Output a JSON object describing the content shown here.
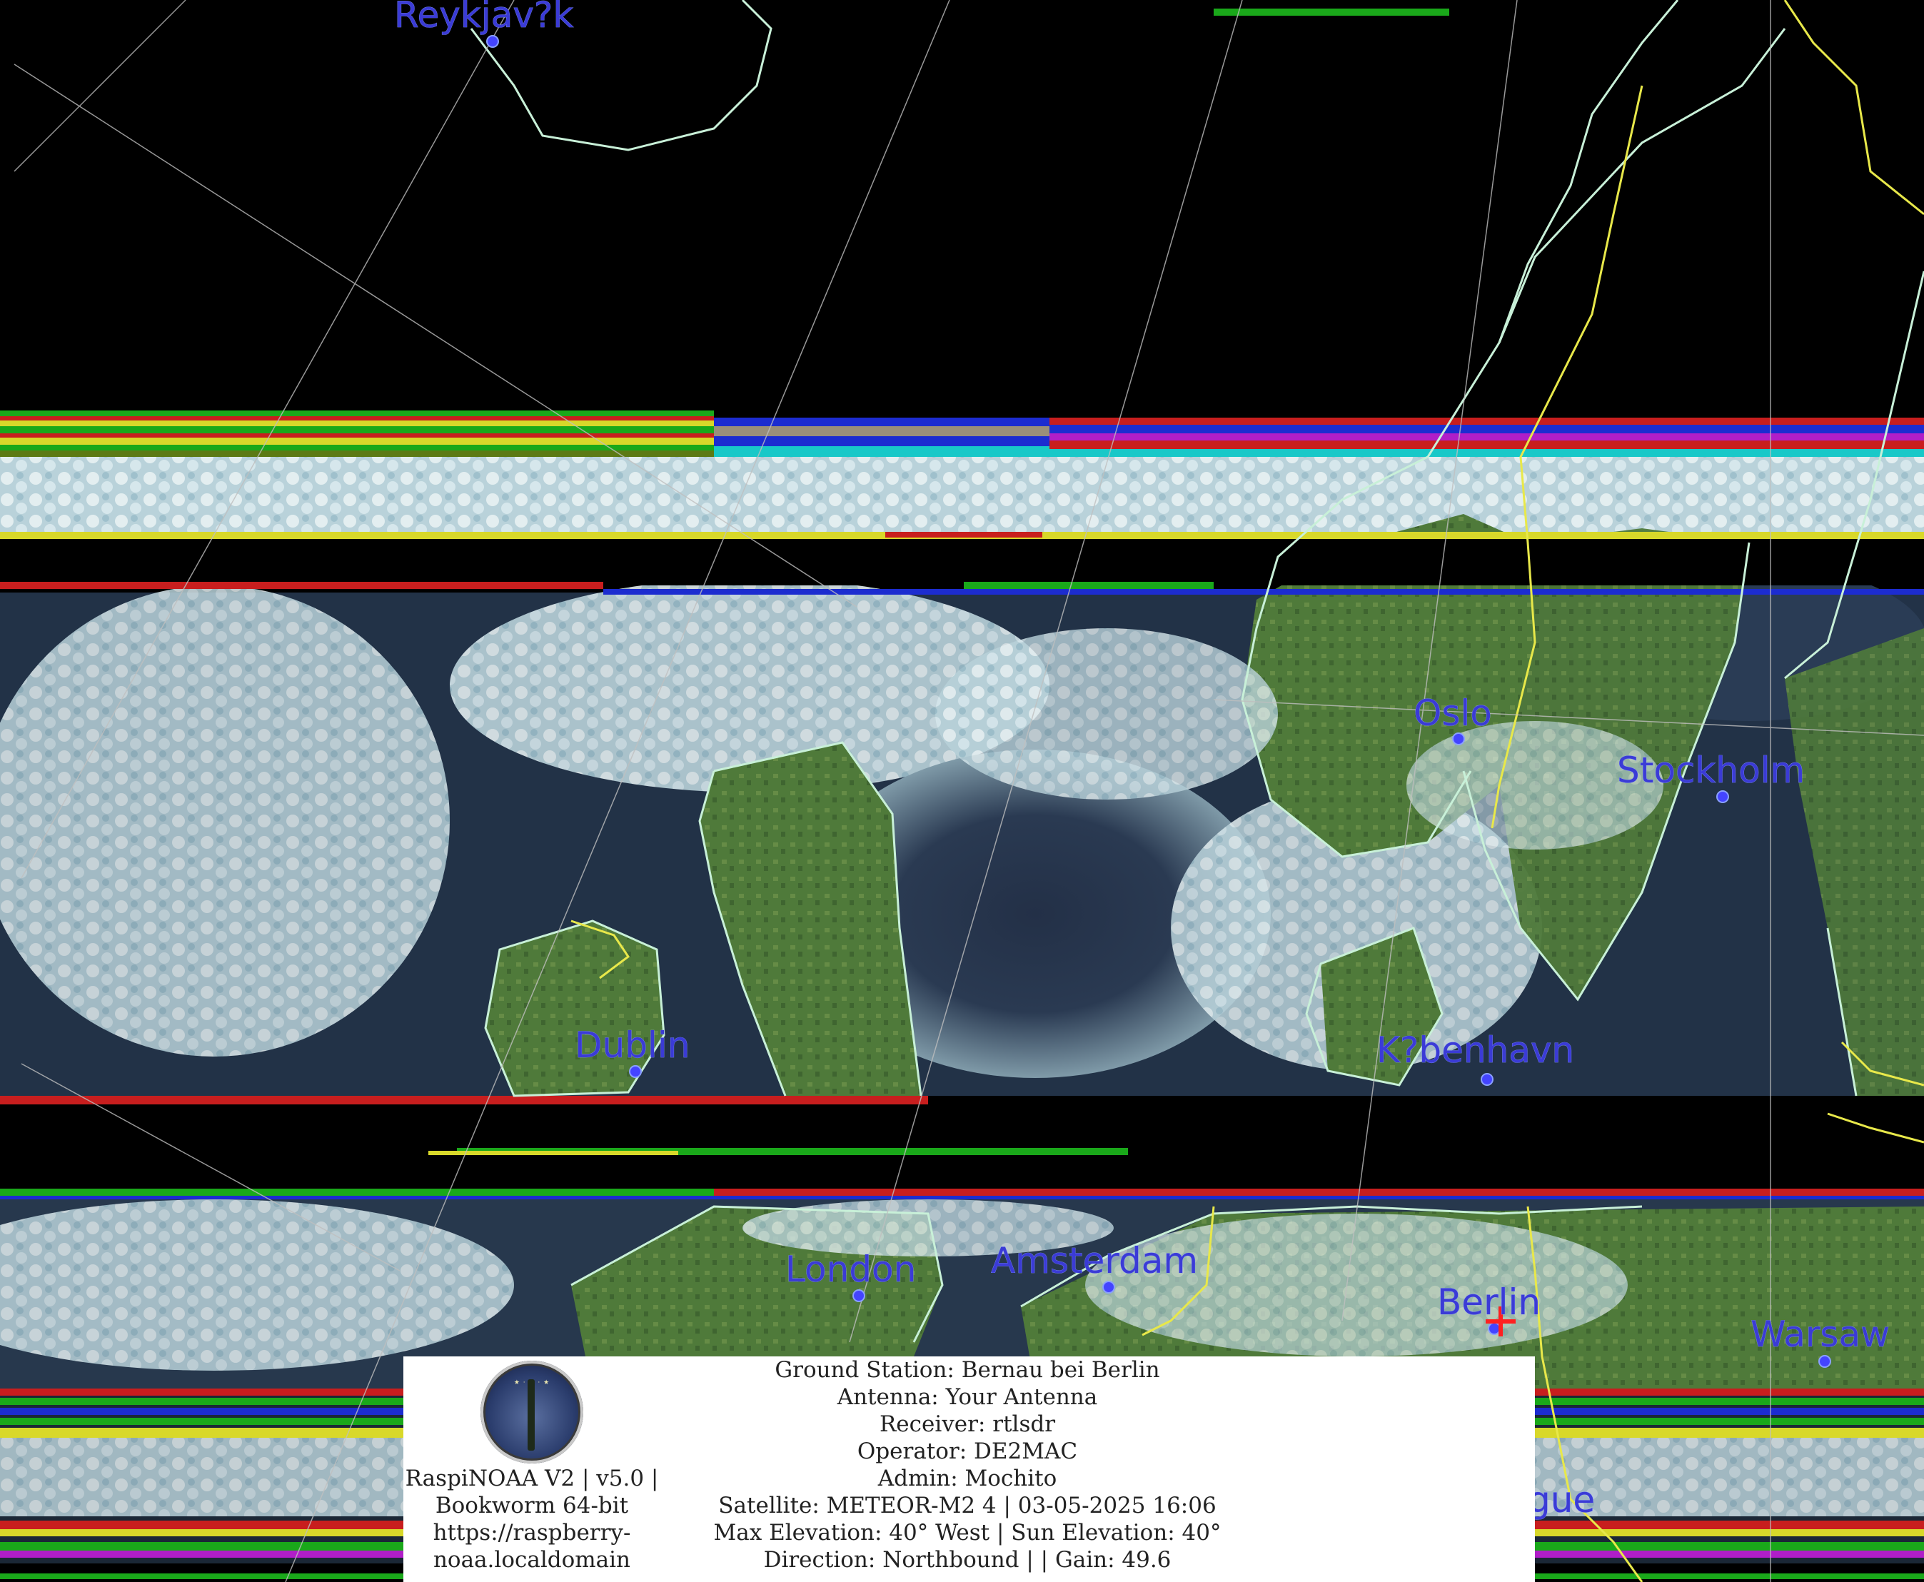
{
  "cities": [
    {
      "id": "reykjavik",
      "label": "Reykjav?k"
    },
    {
      "id": "oslo",
      "label": "Oslo"
    },
    {
      "id": "stockholm",
      "label": "Stockholm"
    },
    {
      "id": "dublin",
      "label": "Dublin"
    },
    {
      "id": "kobenhavn",
      "label": "K?benhavn"
    },
    {
      "id": "london",
      "label": "London"
    },
    {
      "id": "amsterdam",
      "label": "Amsterdam"
    },
    {
      "id": "berlin",
      "label": "Berlin"
    },
    {
      "id": "warsaw",
      "label": "Warsaw"
    },
    {
      "id": "prague-fragment",
      "label": "gue"
    }
  ],
  "colors": {
    "city_label": "#3b3bd6",
    "coastline": "#c8f0d8",
    "border": "#e8e84a",
    "graticule": "#bfbfbf",
    "ground_station_marker": "#ff2020",
    "land": "#4f7a3a",
    "water": "#1a2a44",
    "cloud": "#c9dfe6"
  },
  "info": {
    "app_line1": "RaspiNOAA V2 | v5.0 |",
    "app_line2": "Bookworm 64-bit",
    "app_line3": "https://raspberry-",
    "app_line4": "noaa.localdomain",
    "ground_station": "Ground Station: Bernau bei Berlin",
    "antenna": "Antenna: Your Antenna",
    "receiver": "Receiver: rtlsdr",
    "operator": "Operator: DE2MAC",
    "admin": "Admin: Mochito",
    "satellite": "Satellite: METEOR-M2 4 | 03-05-2025 16:06",
    "elevation": "Max Elevation: 40° West | Sun Elevation: 40°",
    "direction": "Direction: Northbound | | Gain: 49.6"
  },
  "logo": {
    "icon": "raspi-noaa-logo-icon"
  }
}
